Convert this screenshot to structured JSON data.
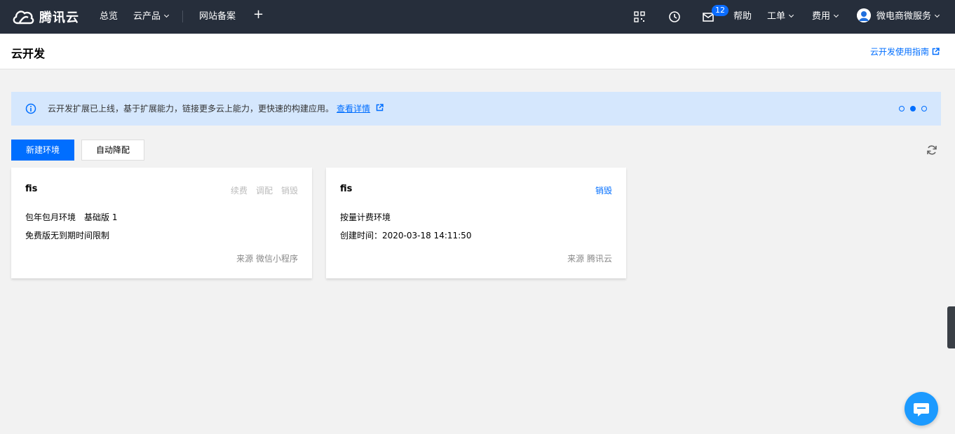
{
  "topnav": {
    "brand": "腾讯云",
    "overview": "总览",
    "products": "云产品",
    "icp": "网站备案",
    "add_symbol": "+",
    "mail_count": "12",
    "help": "帮助",
    "ticket": "工单",
    "billing": "费用",
    "account": "微电商微服务"
  },
  "header": {
    "title": "云开发",
    "guide_link": "云开发使用指南"
  },
  "notice": {
    "text": "云开发扩展已上线，基于扩展能力，链接更多云上能力，更快速的构建应用。",
    "link": "查看详情",
    "carousel_active_index": 1
  },
  "toolbar": {
    "create_label": "新建环境",
    "auto_label": "自动降配"
  },
  "cards": [
    {
      "name": "fis",
      "actions": [
        "续费",
        "调配",
        "销毁"
      ],
      "lines": [
        "包年包月环境　基础版 1",
        "免费版无到期时间限制"
      ],
      "source": "来源 微信小程序"
    },
    {
      "name": "fis",
      "actions": [
        "销毁"
      ],
      "lines": [
        "按量计费环境",
        "创建时间：2020-03-18 14:11:50"
      ],
      "source": "来源 腾讯云"
    }
  ],
  "colors": {
    "nav_bg": "#262e3b",
    "accent": "#006eff",
    "notice_bg": "#d5e7fd",
    "chat": "#1c9aff"
  }
}
